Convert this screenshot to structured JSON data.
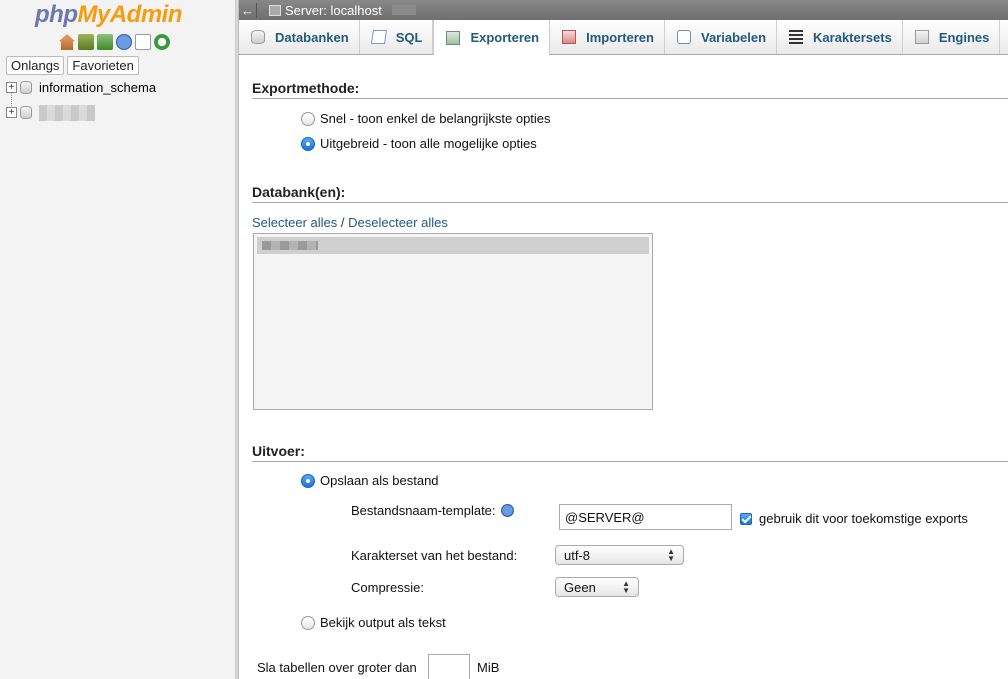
{
  "nav": {
    "logo": {
      "php": "php",
      "my": "My",
      "admin": "Admin"
    },
    "icons": [
      "home-icon",
      "exit-icon",
      "query-window-icon",
      "help-icon",
      "documentation-icon",
      "reload-icon"
    ],
    "tabs": [
      "Onlangs",
      "Favorieten"
    ],
    "tree": [
      {
        "label": "information_schema"
      },
      {
        "label": ""
      }
    ]
  },
  "topbar": {
    "back": "←",
    "server_label": "Server: localhost"
  },
  "tabs": [
    {
      "label": "Databanken",
      "icon": "database-icon"
    },
    {
      "label": "SQL",
      "icon": "sql-icon"
    },
    {
      "label": "Exporteren",
      "icon": "export-icon",
      "active": true
    },
    {
      "label": "Importeren",
      "icon": "import-icon"
    },
    {
      "label": "Variabelen",
      "icon": "variables-icon"
    },
    {
      "label": "Karaktersets",
      "icon": "charset-icon"
    },
    {
      "label": "Engines",
      "icon": "engines-icon"
    }
  ],
  "export_method": {
    "heading": "Exportmethode:",
    "options": [
      {
        "label": "Snel - toon enkel de belangrijkste opties",
        "checked": false
      },
      {
        "label": "Uitgebreid - toon alle mogelijke opties",
        "checked": true
      }
    ]
  },
  "databases": {
    "heading": "Databank(en):",
    "select_all": "Selecteer alles",
    "separator": " / ",
    "deselect_all": "Deselecteer alles"
  },
  "output": {
    "heading": "Uitvoer:",
    "save_as_file": "Opslaan als bestand",
    "filename_template_label": "Bestandsnaam-template:",
    "filename_template_value": "@SERVER@",
    "remember_label": "gebruik dit voor toekomstige exports",
    "charset_label": "Karakterset van het bestand:",
    "charset_value": "utf-8",
    "compression_label": "Compressie:",
    "compression_value": "Geen",
    "view_as_text": "Bekijk output als tekst",
    "skip_tables_label": "Sla tabellen over groter dan",
    "skip_tables_unit": "MiB"
  }
}
